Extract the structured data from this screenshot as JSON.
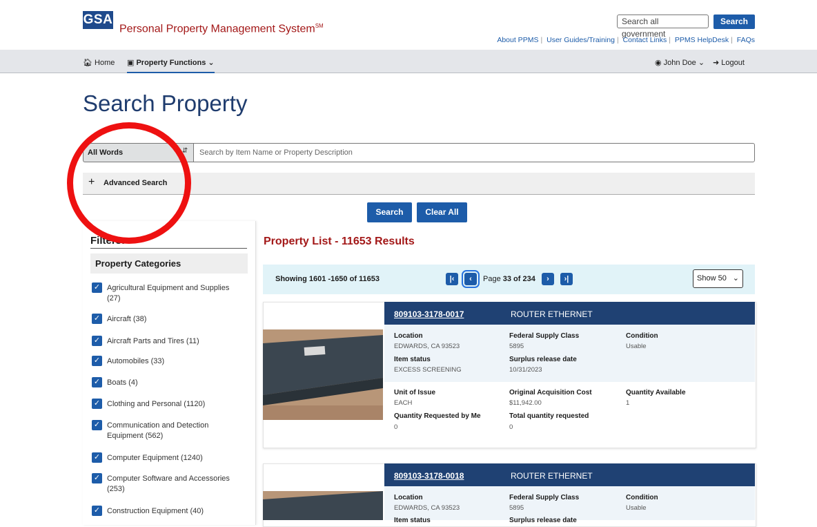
{
  "header": {
    "logo": "GSA",
    "title": "Personal Property Management System",
    "title_mark": "SM",
    "gov_search_placeholder": "Search all government",
    "gov_search_button": "Search",
    "links": [
      "About PPMS",
      "User Guides/Training",
      "Contact Links",
      "PPMS HelpDesk",
      "FAQs"
    ]
  },
  "nav": {
    "home": "Home",
    "property_functions": "Property Functions",
    "user": "John Doe",
    "logout": "Logout"
  },
  "page_title": "Search Property",
  "search": {
    "mode": "All Words",
    "placeholder": "Search by Item Name or Property Description",
    "advanced": "Advanced Search",
    "search_button": "Search",
    "clear_button": "Clear All"
  },
  "filters": {
    "heading": "Filters:",
    "category_heading": "Property Categories",
    "categories": [
      {
        "line1": "Agricultural Equipment and Supplies",
        "line2": "(27)"
      },
      {
        "line1": "Aircraft (38)",
        "line2": ""
      },
      {
        "line1": "Aircraft Parts and Tires (11)",
        "line2": ""
      },
      {
        "line1": "Automobiles (33)",
        "line2": ""
      },
      {
        "line1": "Boats (4)",
        "line2": ""
      },
      {
        "line1": "Clothing and Personal (1120)",
        "line2": ""
      },
      {
        "line1": "Communication and Detection",
        "line2": "Equipment (562)"
      },
      {
        "line1": "Computer Equipment (1240)",
        "line2": ""
      },
      {
        "line1": "Computer Software and Accessories",
        "line2": "(253)"
      },
      {
        "line1": "Construction Equipment (40)",
        "line2": ""
      }
    ]
  },
  "results": {
    "heading": "Property List - 11653 Results",
    "showing": "Showing 1601 -1650  of 11653",
    "page_prefix": "Page ",
    "page_current": "33 of 234",
    "show_select": "Show 50"
  },
  "items": [
    {
      "id": "809103-3178-0017",
      "name": "ROUTER ETHERNET",
      "location_label": "Location",
      "location": "EDWARDS, CA 93523",
      "fsc_label": "Federal Supply Class",
      "fsc": "5895",
      "condition_label": "Condition",
      "condition": "Usable",
      "status_label": "Item status",
      "status": "EXCESS SCREENING",
      "release_label": "Surplus release date",
      "release": "10/31/2023",
      "unit_label": "Unit of Issue",
      "unit": "EACH",
      "cost_label": "Original Acquisition Cost",
      "cost": "$11,942.00",
      "qty_label": "Quantity Available",
      "qty": "1",
      "req_me_label": "Quantity Requested by Me",
      "req_me": "0",
      "total_req_label": "Total quantity requested",
      "total_req": "0"
    },
    {
      "id": "809103-3178-0018",
      "name": "ROUTER ETHERNET",
      "location_label": "Location",
      "location": "EDWARDS, CA 93523",
      "fsc_label": "Federal Supply Class",
      "fsc": "5895",
      "condition_label": "Condition",
      "condition": "Usable",
      "status_label": "Item status",
      "release_label": "Surplus release date"
    }
  ],
  "colors": {
    "brand_blue": "#1d5ca9",
    "navy": "#1f4173",
    "title_red": "#a31818",
    "annotation_red": "#ee1111"
  }
}
